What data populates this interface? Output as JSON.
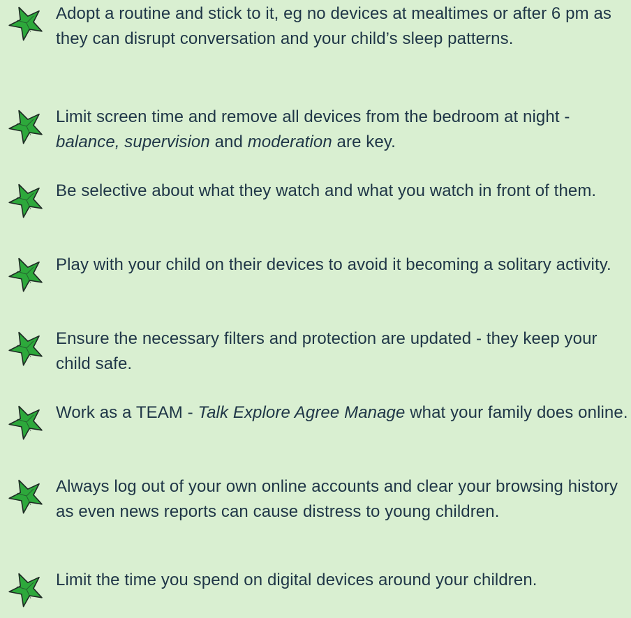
{
  "colors": {
    "background": "#d9efd1",
    "text": "#1f3647",
    "star_fill": "#2da83b",
    "star_outline": "#1e2a24"
  },
  "icon": "star-bullet-icon",
  "tips": [
    {
      "segments": [
        {
          "text": "Adopt a routine and stick to it, eg no devices at mealtimes or after 6 pm as they can disrupt conversation and your child’s sleep patterns.",
          "italic": false
        }
      ]
    },
    {
      "segments": [
        {
          "text": "Limit screen time and remove all devices from the bedroom at night - ",
          "italic": false
        },
        {
          "text": "balance, supervision",
          "italic": true
        },
        {
          "text": " and ",
          "italic": false
        },
        {
          "text": "moderation",
          "italic": true
        },
        {
          "text": " are key.",
          "italic": false
        }
      ]
    },
    {
      "segments": [
        {
          "text": "Be selective about what they watch and what you watch in front of them.",
          "italic": false
        }
      ]
    },
    {
      "segments": [
        {
          "text": "Play with your child on their devices to avoid it becoming a solitary activity.",
          "italic": false
        }
      ]
    },
    {
      "segments": [
        {
          "text": "Ensure the necessary filters and protection are updated - they keep your child safe.",
          "italic": false
        }
      ]
    },
    {
      "segments": [
        {
          "text": "Work as a TEAM - ",
          "italic": false
        },
        {
          "text": "Talk Explore Agree Manage",
          "italic": true
        },
        {
          "text": " what your family does online.",
          "italic": false
        }
      ]
    },
    {
      "segments": [
        {
          "text": "Always log out of your own online accounts and clear your browsing history as even news reports can cause distress to young children.",
          "italic": false
        }
      ]
    },
    {
      "segments": [
        {
          "text": "Limit the time you spend on digital devices around your children.",
          "italic": false
        }
      ]
    }
  ]
}
